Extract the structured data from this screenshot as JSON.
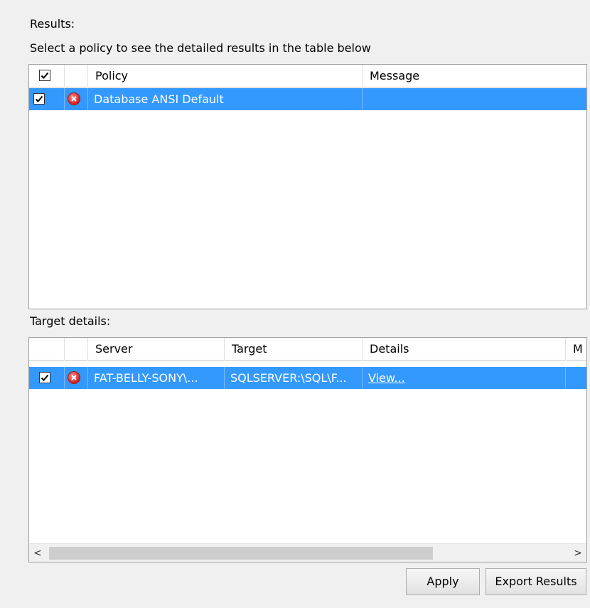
{
  "results_label": "Results:",
  "instruction": "Select a policy to see the detailed results in the table below",
  "policy_table": {
    "columns": [
      "",
      "",
      "Policy",
      "Message"
    ],
    "rows": [
      {
        "checked": true,
        "status": "error-icon",
        "policy": "Database ANSI Default",
        "message": ""
      }
    ]
  },
  "target_label": "Target details:",
  "target_table": {
    "columns": [
      "",
      "",
      "Server",
      "Target",
      "Details",
      "M"
    ],
    "rows": [
      {
        "checked": true,
        "status": "error-icon",
        "server": "FAT-BELLY-SONY\\...",
        "target": "SQLSERVER:\\SQL\\F...",
        "details": "View...",
        "m": ""
      }
    ]
  },
  "scroll": {
    "left_arrow": "<",
    "right_arrow": ">"
  },
  "buttons": {
    "apply": "Apply",
    "export": "Export Results"
  },
  "colors": {
    "selection": "#3399ff",
    "error": "#d02020"
  }
}
